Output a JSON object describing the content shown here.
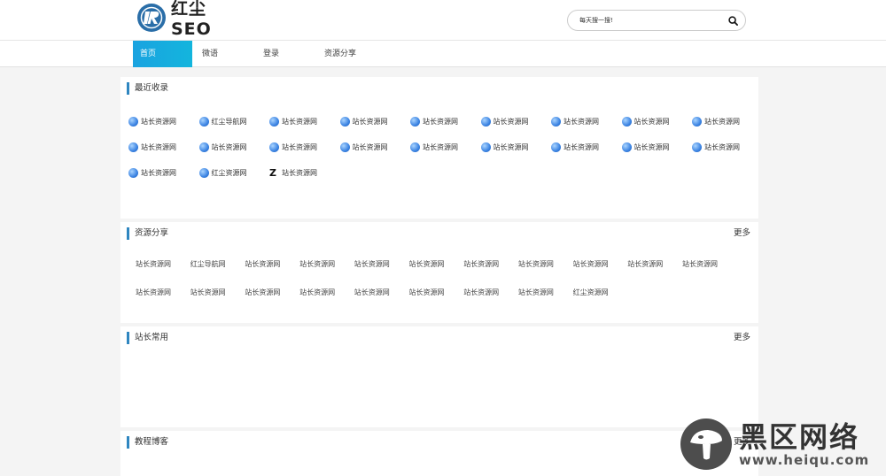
{
  "header": {
    "logo_text": "红尘SEO",
    "search_placeholder": "每天搜一搜!"
  },
  "nav": {
    "items": [
      "首页",
      "微语",
      "登录",
      "资源分享"
    ]
  },
  "recent": {
    "title": "最近收录",
    "items": [
      {
        "label": "站长资源网",
        "icon": "globe-icon"
      },
      {
        "label": "红尘导航网",
        "icon": "globe-icon"
      },
      {
        "label": "站长资源网",
        "icon": "globe-icon"
      },
      {
        "label": "站长资源网",
        "icon": "globe-icon"
      },
      {
        "label": "站长资源网",
        "icon": "globe-icon"
      },
      {
        "label": "站长资源网",
        "icon": "globe-icon"
      },
      {
        "label": "站长资源网",
        "icon": "globe-icon"
      },
      {
        "label": "站长资源网",
        "icon": "globe-icon"
      },
      {
        "label": "站长资源网",
        "icon": "globe-icon"
      },
      {
        "label": "站长资源网",
        "icon": "globe-icon"
      },
      {
        "label": "站长资源网",
        "icon": "globe-icon"
      },
      {
        "label": "站长资源网",
        "icon": "globe-icon"
      },
      {
        "label": "站长资源网",
        "icon": "globe-icon"
      },
      {
        "label": "站长资源网",
        "icon": "globe-icon"
      },
      {
        "label": "站长资源网",
        "icon": "globe-icon"
      },
      {
        "label": "站长资源网",
        "icon": "globe-icon"
      },
      {
        "label": "站长资源网",
        "icon": "globe-icon"
      },
      {
        "label": "站长资源网",
        "icon": "globe-icon"
      },
      {
        "label": "站长资源网",
        "icon": "globe-icon"
      },
      {
        "label": "红尘资源网",
        "icon": "globe-icon"
      },
      {
        "label": "站长资源网",
        "icon": "z-logo-icon"
      }
    ]
  },
  "resources": {
    "title": "资源分享",
    "more": "更多",
    "items": [
      "站长资源网",
      "红尘导航网",
      "站长资源网",
      "站长资源网",
      "站长资源网",
      "站长资源网",
      "站长资源网",
      "站长资源网",
      "站长资源网",
      "站长资源网",
      "站长资源网",
      "站长资源网",
      "站长资源网",
      "站长资源网",
      "站长资源网",
      "站长资源网",
      "站长资源网",
      "站长资源网",
      "站长资源网",
      "红尘资源网"
    ]
  },
  "common": {
    "title": "站长常用",
    "more": "更多"
  },
  "blog": {
    "title": "教程博客",
    "more": "更多"
  },
  "watermark": {
    "cn": "黑区网络",
    "url": "www.heiqu.com"
  },
  "colors": {
    "accent": "#1aa3e0",
    "title_bar": "#2f86c0"
  }
}
